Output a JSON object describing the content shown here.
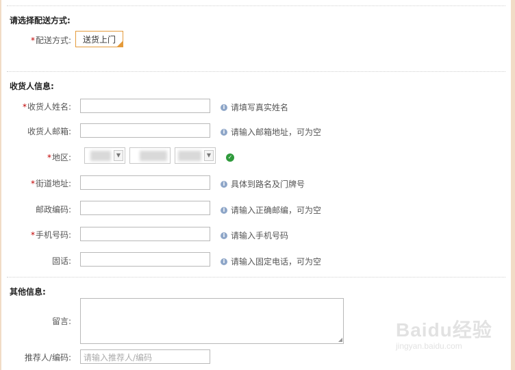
{
  "shipping_section": {
    "title": "请选择配送方式:",
    "method_label": "配送方式:",
    "method_option": "送货上门"
  },
  "receiver_section": {
    "title": "收货人信息:",
    "fields": {
      "name": {
        "label": "收货人姓名:",
        "required": true,
        "hint": "请填写真实姓名",
        "value": ""
      },
      "email": {
        "label": "收货人邮箱:",
        "required": false,
        "hint": "请输入邮箱地址，可为空",
        "value": ""
      },
      "region": {
        "label": "地区:",
        "required": true
      },
      "street": {
        "label": "街道地址:",
        "required": true,
        "hint": "具体到路名及门牌号",
        "value": ""
      },
      "postcode": {
        "label": "邮政编码:",
        "required": false,
        "hint": "请输入正确邮编，可为空",
        "value": ""
      },
      "mobile": {
        "label": "手机号码:",
        "required": true,
        "hint": "请输入手机号码",
        "value": ""
      },
      "phone": {
        "label": "固话:",
        "required": false,
        "hint": "请输入固定电话，可为空",
        "value": ""
      }
    }
  },
  "other_section": {
    "title": "其他信息:",
    "message_label": "留言:",
    "referrer_label": "推荐人/编码:",
    "referrer_placeholder": "请输入推荐人/编码"
  },
  "required_mark": "*",
  "icons": {
    "hint": "info-icon",
    "region_valid": "check-icon"
  },
  "colors": {
    "required": "#c00000",
    "accent_border": "#e49a3a",
    "valid": "#2f9a3c",
    "frame": "#f1dcc6"
  },
  "watermark": {
    "brand": "Baidu经验",
    "url": "jingyan.baidu.com"
  }
}
